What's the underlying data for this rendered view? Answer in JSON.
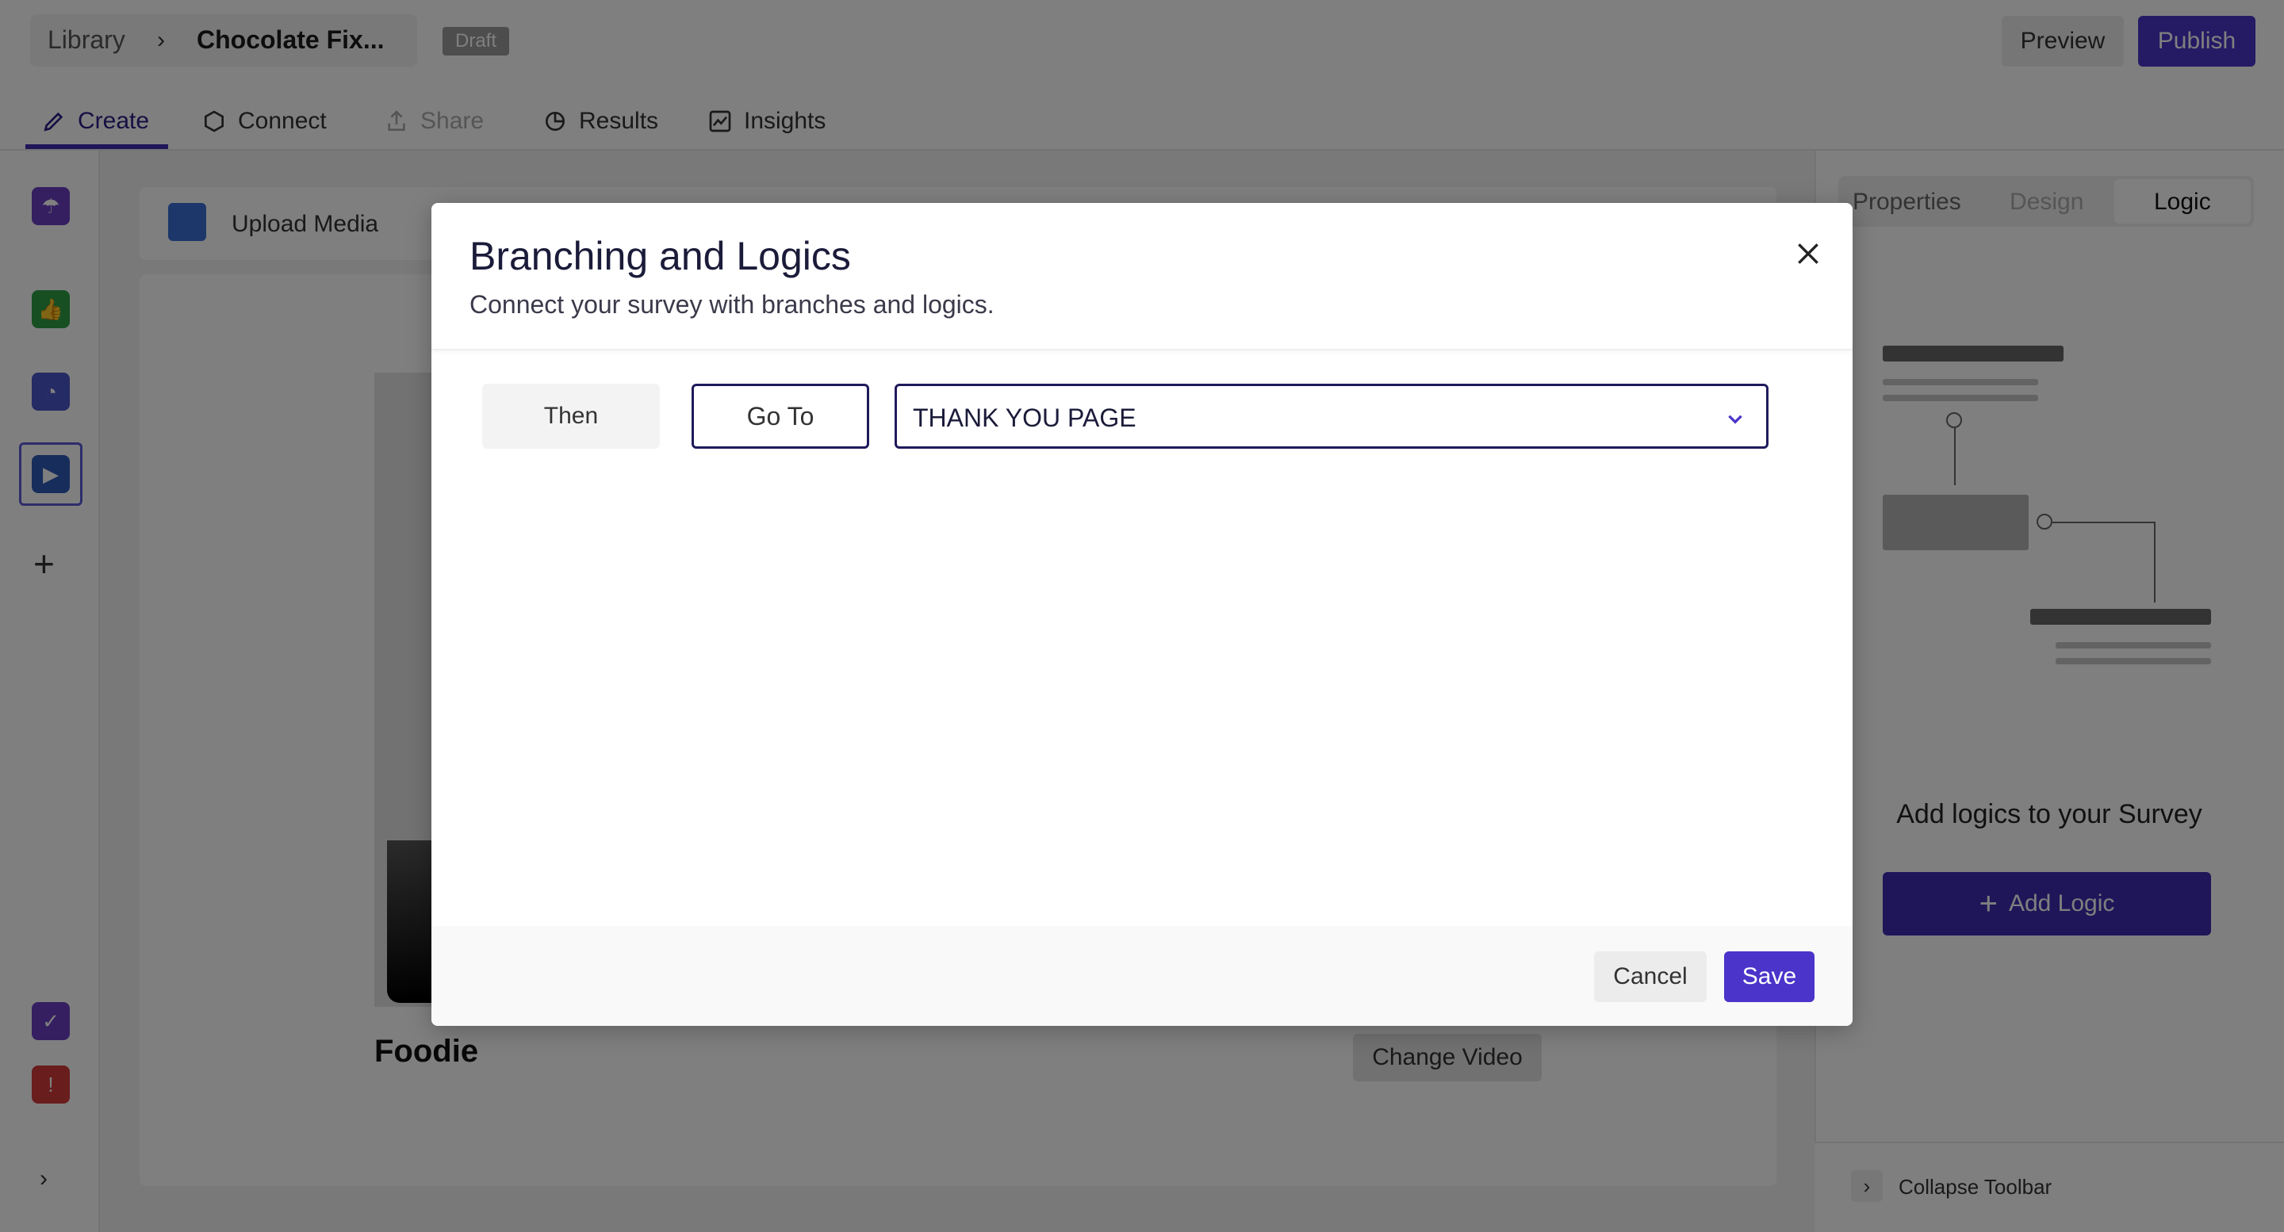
{
  "header": {
    "breadcrumb_root": "Library",
    "breadcrumb_title": "Chocolate Fix...",
    "status_badge": "Draft",
    "preview_label": "Preview",
    "publish_label": "Publish"
  },
  "nav_tabs": [
    {
      "label": "Create",
      "icon": "pencil-icon",
      "state": "active"
    },
    {
      "label": "Connect",
      "icon": "hexagon-icon",
      "state": "normal"
    },
    {
      "label": "Share",
      "icon": "share-icon",
      "state": "disabled"
    },
    {
      "label": "Results",
      "icon": "pie-chart-icon",
      "state": "normal"
    },
    {
      "label": "Insights",
      "icon": "line-chart-icon",
      "state": "normal"
    }
  ],
  "left_rail": {
    "items": [
      {
        "icon": "welcome-icon",
        "color": "#6a3fc2"
      },
      {
        "icon": "thumbs-up-icon",
        "color": "#2f9e44"
      },
      {
        "icon": "rating-icon",
        "color": "#4a56c9"
      },
      {
        "icon": "video-icon",
        "color": "#2f5bb8",
        "selected": true
      },
      {
        "icon": "thank-you-icon",
        "color": "#6a3fc2"
      },
      {
        "icon": "alert-icon",
        "color": "#d43a3a"
      }
    ]
  },
  "editor": {
    "upload_media_label": "Upload Media",
    "question_title": "Foodie",
    "change_video_label": "Change Video"
  },
  "right_panel": {
    "tabs": [
      {
        "label": "Properties",
        "state": "normal"
      },
      {
        "label": "Design",
        "state": "disabled"
      },
      {
        "label": "Logic",
        "state": "active"
      }
    ],
    "empty_heading": "Add logics to your Survey",
    "add_logic_label": "Add Logic",
    "collapse_label": "Collapse Toolbar"
  },
  "modal": {
    "title": "Branching and Logics",
    "subtitle": "Connect your survey with branches and logics.",
    "rule": {
      "then_label": "Then",
      "action_label": "Go To",
      "destination_value": "THANK YOU PAGE"
    },
    "cancel_label": "Cancel",
    "save_label": "Save"
  },
  "colors": {
    "brand": "#4a34c9",
    "overlay": "rgba(0,0,0,0.5)"
  }
}
